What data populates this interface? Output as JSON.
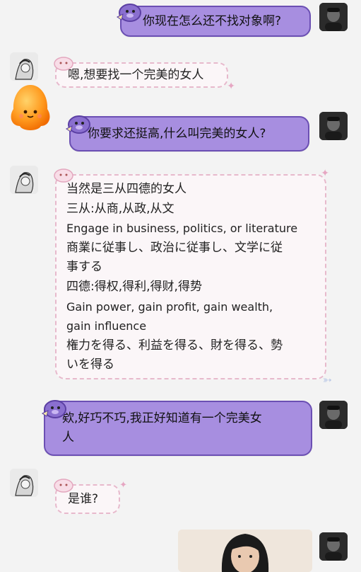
{
  "messages": [
    {
      "side": "right",
      "text": "你现在怎么还不找对象啊?"
    },
    {
      "side": "left",
      "text": "嗯,想要找一个完美的女人"
    },
    {
      "side": "right",
      "text": "你要求还挺高,什么叫完美的女人?"
    },
    {
      "side": "left",
      "lines": [
        "当然是三从四德的女人",
        "三从:从商,从政,从文",
        "Engage in business, politics, or literature",
        "商業に従事し、政治に従事し、文学に従",
        "事する",
        "四德:得权,得利,得财,得势",
        "Gain power, gain profit, gain wealth,",
        "gain influence",
        "権力を得る、利益を得る、財を得る、勢",
        "いを得る"
      ]
    },
    {
      "side": "right",
      "lines": [
        "欸,好巧不巧,我正好知道有一个完美女",
        "人"
      ]
    },
    {
      "side": "left",
      "text": "是谁?"
    }
  ],
  "icons": {
    "self_avatar": "dark-portrait-avatar",
    "friend_avatar": "sketch-portrait-avatar",
    "sticker": "orange-blob-sticker",
    "bubble_decoration": "pig-sticker-icon",
    "photo": "woman-photo-thumbnail"
  },
  "colors": {
    "right_bubble": "#a78ee0",
    "right_border": "#6b4fb3",
    "left_bubble": "#fbf6f8",
    "left_border": "#e7b9cc",
    "background": "#f3f3f3"
  }
}
